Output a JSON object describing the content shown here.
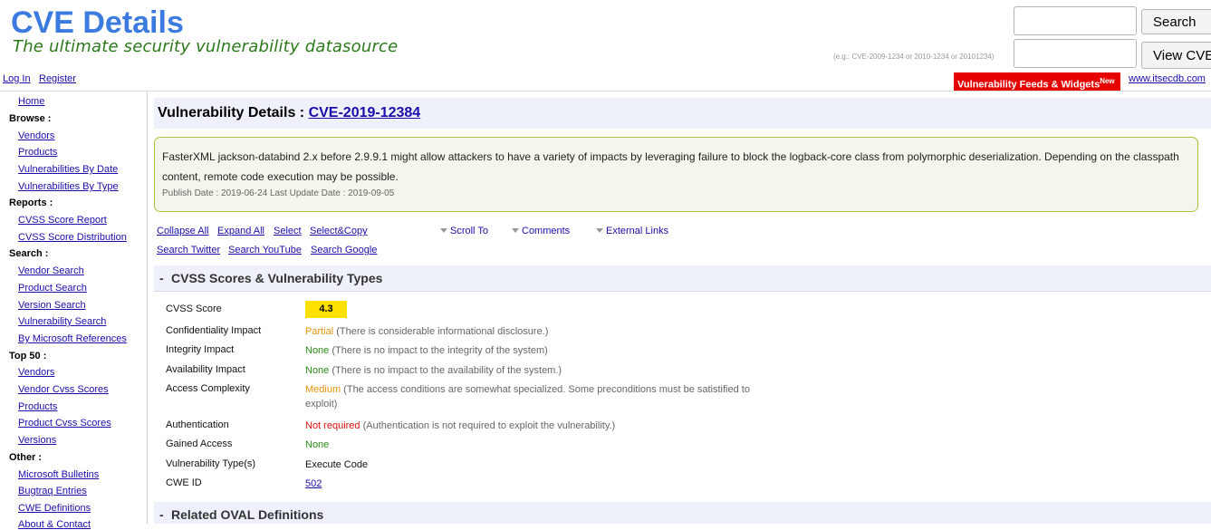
{
  "header": {
    "site_title": "CVE Details",
    "tagline": "The ultimate security vulnerability datasource",
    "search_button": "Search",
    "view_cve_button": "View CVE",
    "example_hint": "(e.g.: CVE-2009-1234 or 2010-1234 or 20101234)",
    "login": "Log In",
    "register": "Register",
    "feeds_banner": "Vulnerability Feeds & Widgets",
    "feeds_banner_badge": "New",
    "itsecdb": "www.itsecdb.com"
  },
  "sidebar": {
    "home": "Home",
    "browse_heading": "Browse :",
    "browse": [
      "Vendors",
      "Products",
      "Vulnerabilities By Date",
      "Vulnerabilities By Type"
    ],
    "reports_heading": "Reports :",
    "reports": [
      "CVSS Score Report",
      "CVSS Score Distribution"
    ],
    "search_heading": "Search :",
    "search": [
      "Vendor Search",
      "Product Search",
      "Version Search",
      "Vulnerability Search",
      "By Microsoft References"
    ],
    "top50_heading": "Top 50 :",
    "top50": [
      "Vendors",
      "Vendor Cvss Scores",
      "Products",
      "Product Cvss Scores",
      "Versions"
    ],
    "other_heading": "Other :",
    "other": [
      "Microsoft Bulletins",
      "Bugtraq Entries",
      "CWE Definitions",
      "About & Contact"
    ]
  },
  "main": {
    "title_prefix": "Vulnerability Details : ",
    "cve_id": "CVE-2019-12384",
    "summary": "FasterXML jackson-databind 2.x before 2.9.9.1 might allow attackers to have a variety of impacts by leveraging failure to block the logback-core class from polymorphic deserialization. Depending on the classpath content, remote code execution may be possible.",
    "dates": "Publish Date : 2019-06-24 Last Update Date : 2019-09-05",
    "tools": {
      "collapse_all": "Collapse All",
      "expand_all": "Expand All",
      "select": "Select",
      "select_copy": "Select&Copy",
      "scroll_to": "Scroll To",
      "comments": "Comments",
      "external_links": "External Links",
      "search_twitter": "Search Twitter",
      "search_youtube": "Search YouTube",
      "search_google": "Search Google"
    },
    "cvss_section": {
      "toggle": "-",
      "title": "CVSS Scores & Vulnerability Types",
      "cvss_label": "CVSS Score",
      "cvss_score": "4.3",
      "rows": [
        {
          "label": "Confidentiality Impact",
          "value": "Partial",
          "desc": " (There is considerable informational disclosure.)"
        },
        {
          "label": "Integrity Impact",
          "value": "None",
          "desc": " (There is no impact to the integrity of the system)"
        },
        {
          "label": "Availability Impact",
          "value": "None",
          "desc": " (There is no impact to the availability of the system.)"
        },
        {
          "label": "Access Complexity",
          "value": "Medium",
          "desc": " (The access conditions are somewhat specialized. Some preconditions must be satistified to exploit)"
        },
        {
          "label": "Authentication",
          "value": "Not required",
          "desc": " (Authentication is not required to exploit the vulnerability.)"
        },
        {
          "label": "Gained Access",
          "value": "None",
          "desc": ""
        }
      ],
      "vuln_type_label": "Vulnerability Type(s)",
      "vuln_type_value": "Execute Code",
      "cwe_label": "CWE ID",
      "cwe_value": "502"
    },
    "oval_section": {
      "toggle": "-",
      "title": "Related OVAL Definitions"
    }
  },
  "colors": {
    "brand_blue": "#3b7be0",
    "tagline_green": "#2a7a19",
    "banner_red": "#e60000",
    "badge_yellow": "#ffe100",
    "partial_orange": "#e6930b",
    "none_green": "#2a8a18",
    "not_required_red": "#dd1111"
  }
}
